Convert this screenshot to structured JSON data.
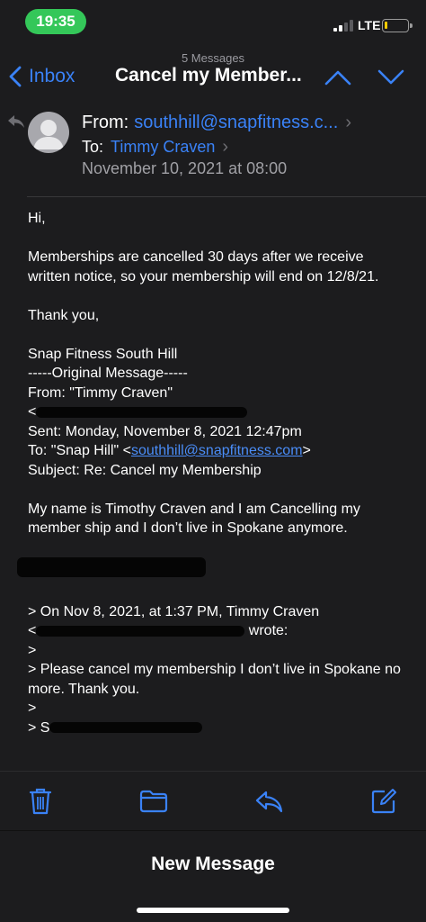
{
  "status_bar": {
    "time": "19:35",
    "network": "LTE",
    "battery_level": 0.1,
    "colors": {
      "time_pill": "#34c759",
      "battery": "#ffcc00"
    }
  },
  "nav": {
    "back_label": "Inbox",
    "message_count": "5 Messages",
    "title": "Cancel my Member...",
    "up_icon": "chevron-up-icon",
    "down_icon": "chevron-down-icon"
  },
  "header": {
    "from_label": "From:",
    "from_address": "southhill@snapfitness.c...",
    "to_label": "To:",
    "to_name": "Timmy Craven",
    "date": "November 10, 2021 at 08:00"
  },
  "body": {
    "greeting": "Hi,",
    "para1": "Memberships are cancelled 30 days after we receive written notice, so your membership will end on 12/8/21.",
    "thanks": "Thank you,",
    "signature": "Snap Fitness South Hill",
    "original_marker": "-----Original Message-----",
    "orig_from": "From: \"Timmy Craven\"",
    "orig_from_email_prefix": "<",
    "orig_sent": "Sent: Monday, November 8, 2021 12:47pm",
    "orig_to_prefix": "To: \"Snap Hill\" <",
    "orig_to_email": "southhill@snapfitness.com",
    "orig_to_suffix": ">",
    "orig_subject": "Subject: Re: Cancel my Membership",
    "orig_body": "My name is Timothy Craven and I am Cancelling my member ship and I don’t live in Spokane anymore.",
    "quote_header": "> On Nov 8, 2021, at 1:37 PM, Timmy Craven",
    "quote_email_prefix": "<",
    "quote_wrote": "wrote:",
    "quote_blank": ">",
    "quote_text": "> Please cancel my membership I don’t live in Spokane no more. Thank you.",
    "quote_blank2": ">",
    "quote_last_prefix": "> S"
  },
  "toolbar": {
    "trash_icon": "trash-icon",
    "folder_icon": "folder-icon",
    "reply_icon": "reply-icon",
    "compose_icon": "compose-icon",
    "accent": "#3a82f7"
  },
  "sheet": {
    "new_message_label": "New Message"
  }
}
